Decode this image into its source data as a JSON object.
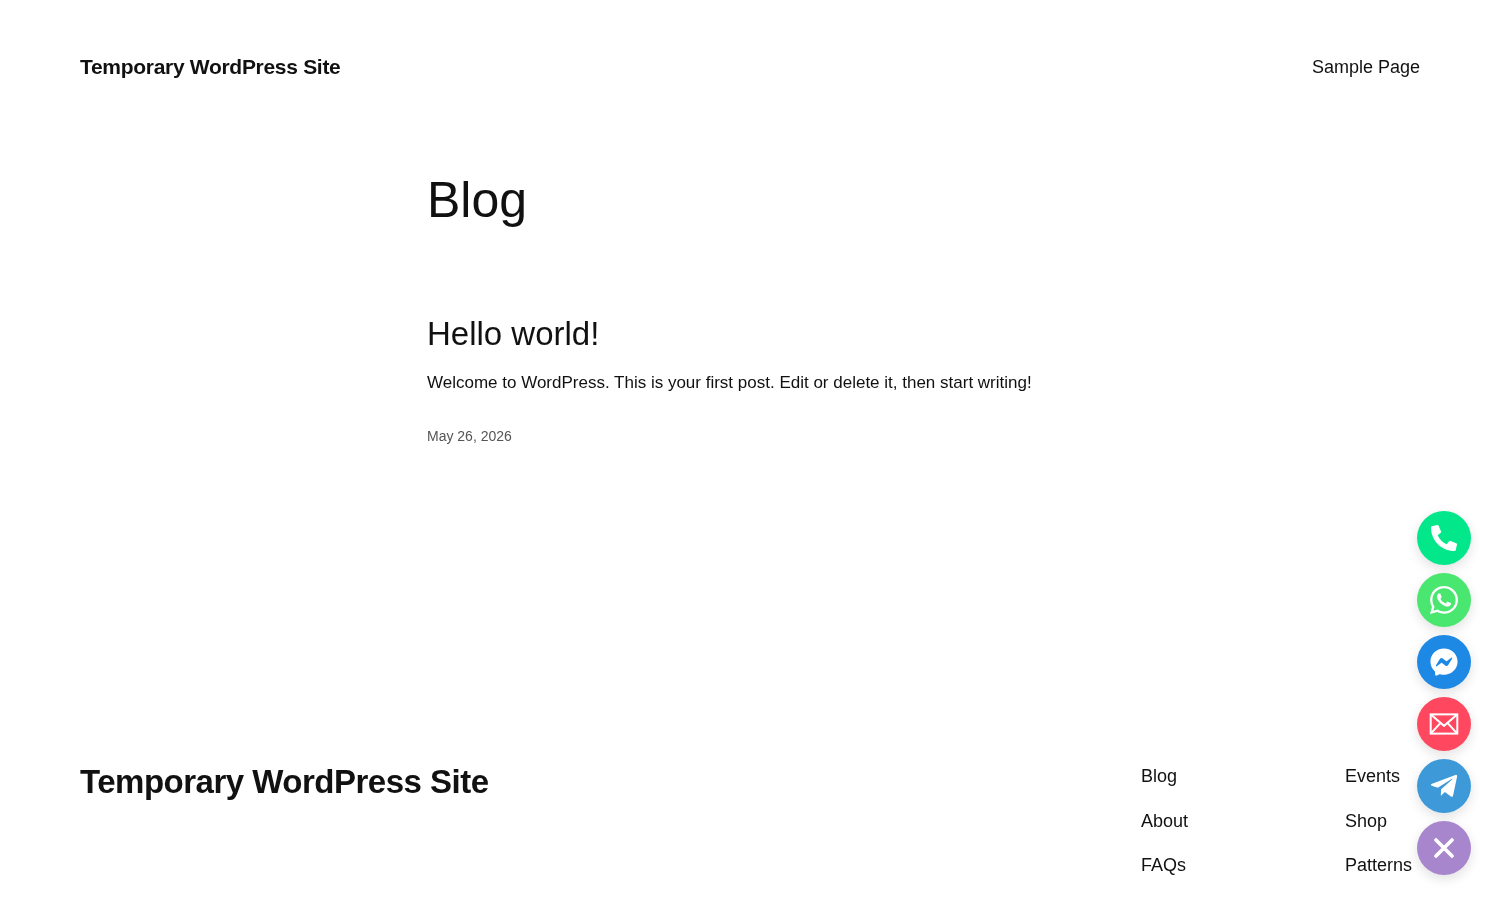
{
  "header": {
    "site_title": "Temporary WordPress Site",
    "nav": [
      "Sample Page"
    ]
  },
  "page_title": "Blog",
  "posts": [
    {
      "title": "Hello world!",
      "excerpt": "Welcome to WordPress. This is your first post. Edit or delete it, then start writing!",
      "date": "May 26, 2026"
    }
  ],
  "footer": {
    "site_title": "Temporary WordPress Site",
    "nav_columns": [
      [
        "Blog",
        "About",
        "FAQs"
      ],
      [
        "Events",
        "Shop",
        "Patterns"
      ]
    ]
  },
  "contact_buttons": [
    {
      "kind": "phone",
      "color": "#03e78b"
    },
    {
      "kind": "whatsapp",
      "color": "#49e670"
    },
    {
      "kind": "messenger",
      "color": "#1e88e5"
    },
    {
      "kind": "email",
      "color": "#ff485f"
    },
    {
      "kind": "telegram",
      "color": "#3e99d8"
    },
    {
      "kind": "close",
      "color": "#a886cd"
    }
  ]
}
